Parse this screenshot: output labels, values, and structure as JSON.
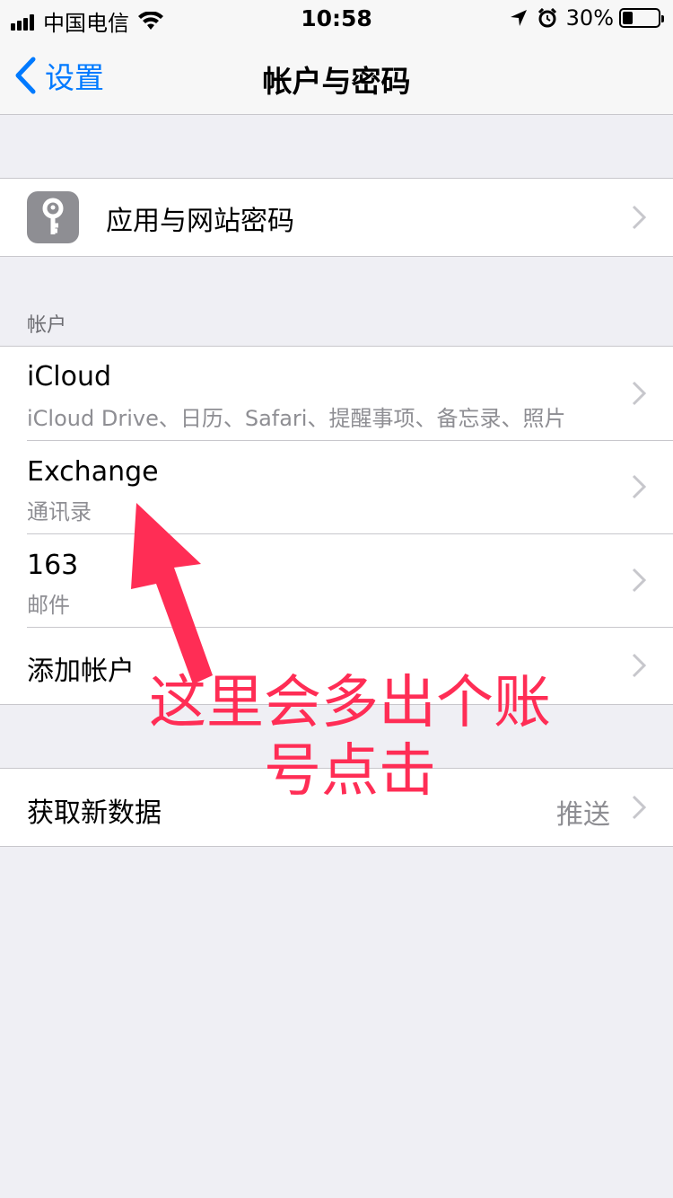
{
  "status_bar": {
    "carrier": "中国电信",
    "time": "10:58",
    "battery": "30%",
    "battery_level": 0.3,
    "icons": [
      "signal-icon",
      "wifi-icon",
      "location-icon",
      "alarm-icon",
      "battery-icon"
    ]
  },
  "nav": {
    "back_label": "设置",
    "title": "帐户与密码"
  },
  "passwords_row": {
    "label": "应用与网站密码",
    "icon": "key-icon"
  },
  "accounts": {
    "header": "帐户",
    "items": [
      {
        "title": "iCloud",
        "subtitle": "iCloud Drive、日历、Safari、提醒事项、备忘录、照片"
      },
      {
        "title": "Exchange",
        "subtitle": "通讯录"
      },
      {
        "title": "163",
        "subtitle": "邮件"
      },
      {
        "title": "添加帐户"
      }
    ]
  },
  "fetch_row": {
    "label": "获取新数据",
    "value": "推送"
  },
  "annotation": {
    "line1": "这里会多出个账",
    "line2": "号点击",
    "color": "#ff2d55"
  },
  "colors": {
    "accent": "#007aff",
    "background": "#efeff4",
    "secondary_text": "#8e8e93"
  }
}
